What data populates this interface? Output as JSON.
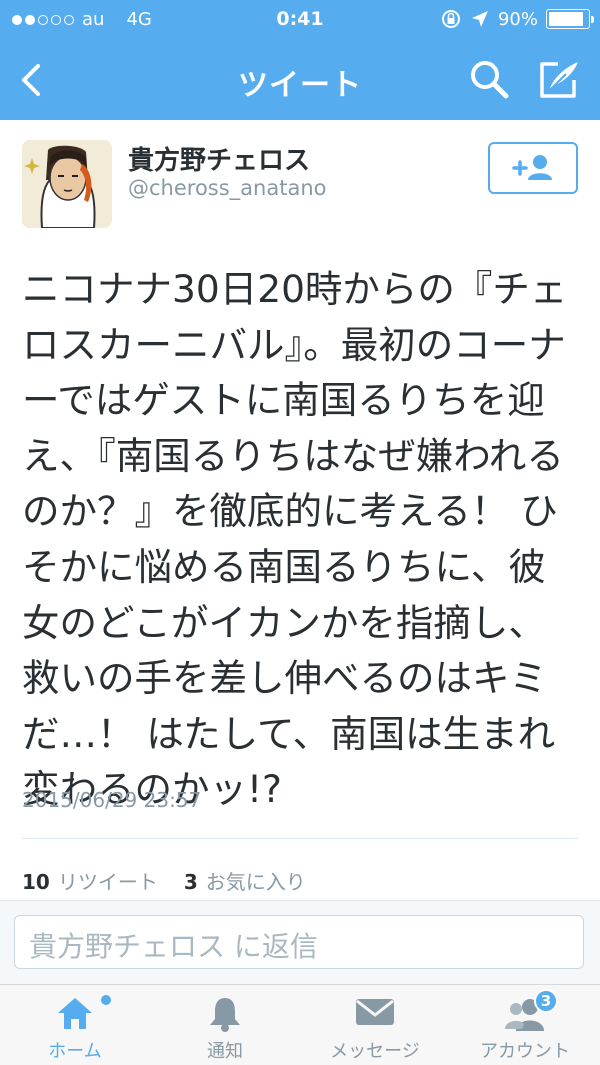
{
  "status_bar": {
    "carrier": "au",
    "network": "4G",
    "time": "0:41",
    "battery_percent": "90%",
    "battery_level": 0.9,
    "signal_dots_filled": 2,
    "signal_dots_total": 5
  },
  "nav": {
    "title": "ツイート",
    "back_icon": "chevron-left-icon",
    "search_icon": "search-icon",
    "compose_icon": "compose-icon"
  },
  "tweet": {
    "display_name": "貴方野チェロス",
    "handle": "@cheross_anatano",
    "text": "ニコナナ30日20時からの『チェロスカーニバル』。最初のコーナーではゲストに南国るりちを迎え、『南国るりちはなぜ嫌われるのか？』を徹底的に考える！ ひそかに悩める南国るりちに、彼女のどこがイカンかを指摘し、救いの手を差し伸べるのはキミだ…！ はたして、南国は生まれ変わるのかッ!?",
    "timestamp": "2015/06/29 23:57",
    "retweet_count": "10",
    "retweet_label": "リツイート",
    "favorite_count": "3",
    "favorite_label": "お気に入り"
  },
  "reply": {
    "placeholder": "貴方野チェロス に返信"
  },
  "tabs": [
    {
      "label": "ホーム",
      "icon": "home-icon",
      "active": true
    },
    {
      "label": "通知",
      "icon": "bell-icon",
      "active": false
    },
    {
      "label": "メッセージ",
      "icon": "envelope-icon",
      "active": false
    },
    {
      "label": "アカウント",
      "icon": "account-icon",
      "active": false,
      "badge": "3"
    }
  ],
  "colors": {
    "accent": "#55acee",
    "text": "#292f33",
    "muted": "#8899a6"
  }
}
